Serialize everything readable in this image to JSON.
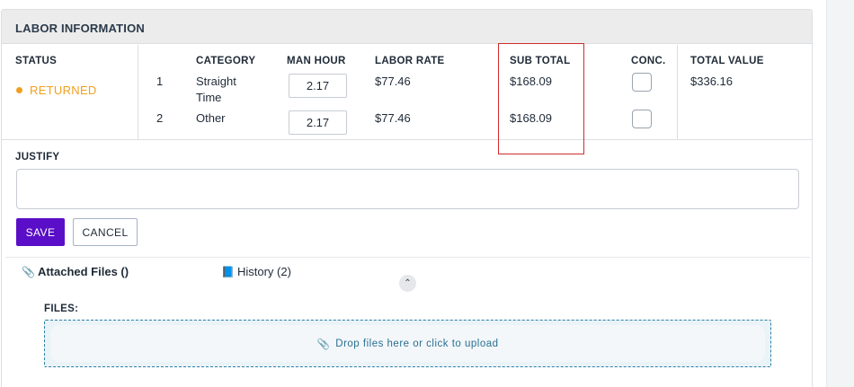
{
  "panel": {
    "title": "LABOR INFORMATION"
  },
  "columns": {
    "status": "STATUS",
    "category": "CATEGORY",
    "man_hour": "MAN HOUR",
    "labor_rate": "LABOR RATE",
    "sub_total": "SUB TOTAL",
    "conc": "CONC.",
    "total_value": "TOTAL VALUE"
  },
  "status": {
    "text": "RETURNED",
    "color": "#f0a020"
  },
  "rows": [
    {
      "num": "1",
      "category_line1": "Straight",
      "category_line2": "Time",
      "man_hour": "2.17",
      "labor_rate": "$77.46",
      "sub_total": "$168.09",
      "conc_checked": false
    },
    {
      "num": "2",
      "category_line1": "Other",
      "category_line2": "",
      "man_hour": "2.17",
      "labor_rate": "$77.46",
      "sub_total": "$168.09",
      "conc_checked": false
    }
  ],
  "total_value": "$336.16",
  "justify": {
    "label": "JUSTIFY",
    "value": ""
  },
  "buttons": {
    "save": "SAVE",
    "cancel": "CANCEL"
  },
  "tabs": [
    {
      "label": "Attached Files ()",
      "icon": "paperclip-icon"
    },
    {
      "label": "History (2)",
      "icon": "book-icon"
    }
  ],
  "files": {
    "label": "FILES:",
    "dropzone_text": "Drop files here or click to upload",
    "dropzone_icon": "paperclip-icon"
  },
  "colors": {
    "accent": "#5a0ec8",
    "highlight": "#d12b2b",
    "dropzone_border": "#2c7fa8"
  }
}
